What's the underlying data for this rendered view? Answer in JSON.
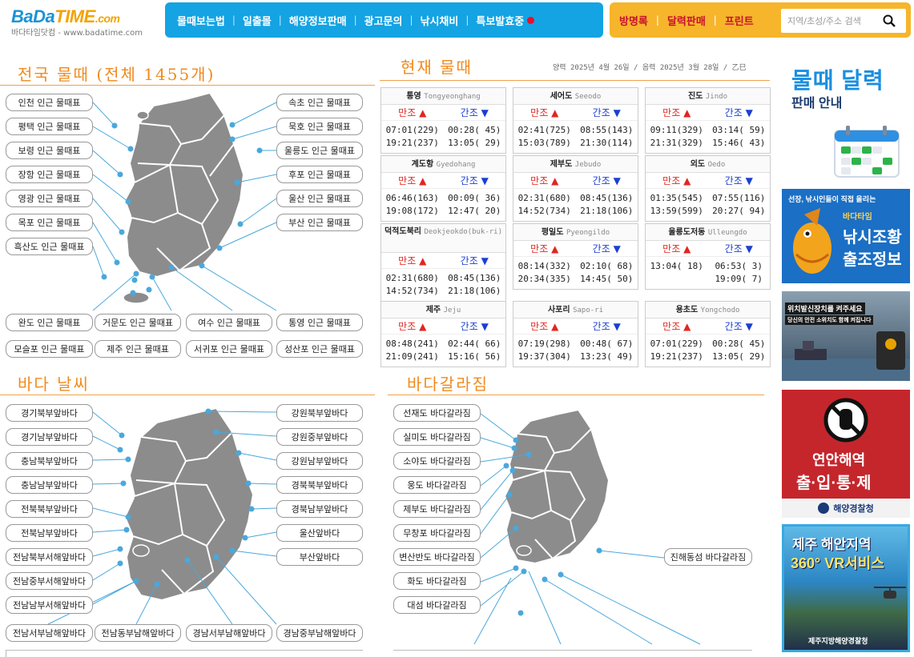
{
  "logo": {
    "ba": "BaDa",
    "time": "TIME",
    "com": ".com",
    "sub": "바다타임닷컴 - www.badatime.com"
  },
  "nav": [
    "물때보는법",
    "일출몰",
    "해양정보판매",
    "광고문의",
    "낚시채비",
    "특보발효중"
  ],
  "nav_right": [
    "방명록",
    "달력판매",
    "프린트"
  ],
  "search": {
    "placeholder": "지역/초성/주소 검색"
  },
  "sections": {
    "national_tide": "전국 물때 (전체 1455개)",
    "current_tide": "현재 물때",
    "weather": "바다 날씨",
    "sea_split": "바다갈라짐"
  },
  "date_line": "양력 2025년 4월 26일 / 음력 2025년 3월 28일 / 乙巳",
  "tide_labels": {
    "left": [
      "인천 인근 물때표",
      "평택 인근 물때표",
      "보령 인근 물때표",
      "장항 인근 물때표",
      "영광 인근 물때표",
      "목포 인근 물때표",
      "흑산도 인근 물때표"
    ],
    "right": [
      "속초 인근 물때표",
      "묵호 인근 물때표",
      "울릉도 인근 물때표",
      "후포 인근 물때표",
      "울산 인근 물때표",
      "부산 인근 물때표"
    ],
    "bottom1": [
      "완도 인근 물때표",
      "거문도 인근 물때표",
      "여수 인근 물때표",
      "통영 인근 물때표"
    ],
    "bottom2": [
      "모슬포 인근 물때표",
      "제주 인근 물때표",
      "서귀포 인근 물때표",
      "성산포 인근 물때표"
    ]
  },
  "tide_cards": [
    {
      "name": "통영",
      "en": "Tongyeonghang",
      "high": "만조",
      "low": "간조",
      "h": [
        "07:01(229)",
        "19:21(237)"
      ],
      "l": [
        "00:28( 45)",
        "13:05( 29)"
      ]
    },
    {
      "name": "세어도",
      "en": "Seeodo",
      "high": "만조",
      "low": "간조",
      "h": [
        "02:41(725)",
        "15:03(789)"
      ],
      "l": [
        "08:55(143)",
        "21:30(114)"
      ]
    },
    {
      "name": "진도",
      "en": "Jindo",
      "high": "만조",
      "low": "간조",
      "h": [
        "09:11(329)",
        "21:31(329)"
      ],
      "l": [
        "03:14( 59)",
        "15:46( 43)"
      ]
    },
    {
      "name": "계도항",
      "en": "Gyedohang",
      "high": "만조",
      "low": "간조",
      "h": [
        "06:46(163)",
        "19:08(172)"
      ],
      "l": [
        "00:09( 36)",
        "12:47( 20)"
      ]
    },
    {
      "name": "제부도",
      "en": "Jebudo",
      "high": "만조",
      "low": "간조",
      "h": [
        "02:31(680)",
        "14:52(734)"
      ],
      "l": [
        "08:45(136)",
        "21:18(106)"
      ]
    },
    {
      "name": "외도",
      "en": "Oedo",
      "high": "만조",
      "low": "간조",
      "h": [
        "01:35(545)",
        "13:59(599)"
      ],
      "l": [
        "07:55(116)",
        "20:27( 94)"
      ]
    },
    {
      "name": "덕적도북리",
      "en": "Deokjeokdo(buk-ri)",
      "high": "만조",
      "low": "간조",
      "h": [
        "02:31(680)",
        "14:52(734)"
      ],
      "l": [
        "08:45(136)",
        "21:18(106)"
      ]
    },
    {
      "name": "평일도",
      "en": "Pyeongildo",
      "high": "만조",
      "low": "간조",
      "h": [
        "08:14(332)",
        "20:34(335)"
      ],
      "l": [
        "02:10( 68)",
        "14:45( 50)"
      ]
    },
    {
      "name": "울릉도저동",
      "en": "Ulleungdo",
      "high": "만조",
      "low": "간조",
      "h": [
        "13:04( 18)",
        ""
      ],
      "l": [
        "06:53(  3)",
        "19:09(  7)"
      ]
    },
    {
      "name": "제주",
      "en": "Jeju",
      "high": "만조",
      "low": "간조",
      "h": [
        "08:48(241)",
        "21:09(241)"
      ],
      "l": [
        "02:44( 66)",
        "15:16( 56)"
      ]
    },
    {
      "name": "사포리",
      "en": "Sapo-ri",
      "high": "만조",
      "low": "간조",
      "h": [
        "07:19(298)",
        "19:37(304)"
      ],
      "l": [
        "00:48( 67)",
        "13:23( 49)"
      ]
    },
    {
      "name": "용초도",
      "en": "Yongchodo",
      "high": "만조",
      "low": "간조",
      "h": [
        "07:01(229)",
        "19:21(237)"
      ],
      "l": [
        "00:28( 45)",
        "13:05( 29)"
      ]
    }
  ],
  "weather_labels": {
    "left": [
      "경기북부앞바다",
      "경기남부앞바다",
      "충남북부앞바다",
      "충남남부앞바다",
      "전북북부앞바다",
      "전북남부앞바다",
      "전남북부서해앞바다",
      "전남중부서해앞바다",
      "전남남부서해앞바다"
    ],
    "right": [
      "강원북부앞바다",
      "강원중부앞바다",
      "강원남부앞바다",
      "경북북부앞바다",
      "경북남부앞바다",
      "울산앞바다",
      "부산앞바다"
    ],
    "bottom": [
      "전남서부남해앞바다",
      "전남동부남해앞바다",
      "경남서부남해앞바다",
      "경남중부남해앞바다"
    ]
  },
  "split_labels": [
    "선재도 바다갈라짐",
    "실미도 바다갈라짐",
    "소야도 바다갈라짐",
    "웅도 바다갈라짐",
    "제부도 바다갈라짐",
    "무창포 바다갈라짐",
    "변산반도 바다갈라짐",
    "화도 바다갈라짐",
    "대섬 바다갈라짐"
  ],
  "split_right": "진해동섬 바다갈라짐",
  "ads": {
    "calendar": {
      "line1": "물때 달력",
      "line2": "판매 안내"
    },
    "fishing": {
      "top": "선장, 낚시인들이 직접 올리는",
      "brand": "바다타임",
      "line1": "낚시조황",
      "line2": "출조정보"
    },
    "signal": {
      "line1": "위치발신장치를 켜주세요",
      "line2": "당신의 안전 소위치도 함께 켜집니다"
    },
    "coast": {
      "line1": "연안해역",
      "line2": "출·입·통·제",
      "org": "해양경찰청"
    },
    "jeju": {
      "line1": "제주 해안지역",
      "line2": "360° VR서비스",
      "org": "제주지방해양경찰청"
    }
  }
}
